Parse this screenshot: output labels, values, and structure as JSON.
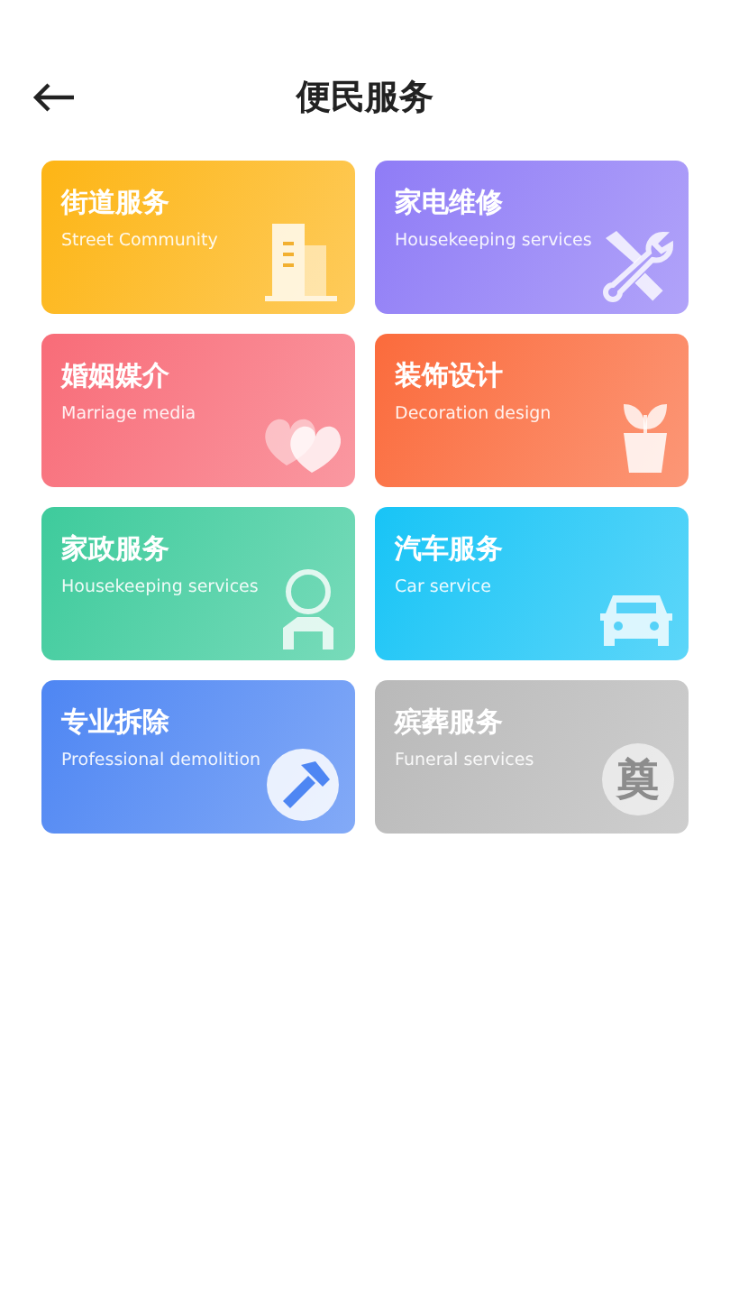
{
  "header": {
    "title": "便民服务"
  },
  "services": [
    {
      "title": "街道服务",
      "subtitle": "Street Community",
      "kind": "building",
      "color": "#fdb515"
    },
    {
      "title": "家电维修",
      "subtitle": "Housekeeping services",
      "kind": "tools",
      "color": "#8f7cf6"
    },
    {
      "title": "婚姻媒介",
      "subtitle": "Marriage media",
      "kind": "hearts",
      "color": "#f86c78"
    },
    {
      "title": "装饰设计",
      "subtitle": "Decoration design",
      "kind": "plant",
      "color": "#fb6b3c"
    },
    {
      "title": "家政服务",
      "subtitle": "Housekeeping services",
      "kind": "person",
      "color": "#3ecb9c"
    },
    {
      "title": "汽车服务",
      "subtitle": "Car service",
      "kind": "car",
      "color": "#18c4f6"
    },
    {
      "title": "专业拆除",
      "subtitle": "Professional demolition",
      "kind": "demolition",
      "color": "#4e86f3"
    },
    {
      "title": "殡葬服务",
      "subtitle": "Funeral services",
      "kind": "funeral",
      "color": "#b9b9b9",
      "badge": "奠"
    }
  ]
}
